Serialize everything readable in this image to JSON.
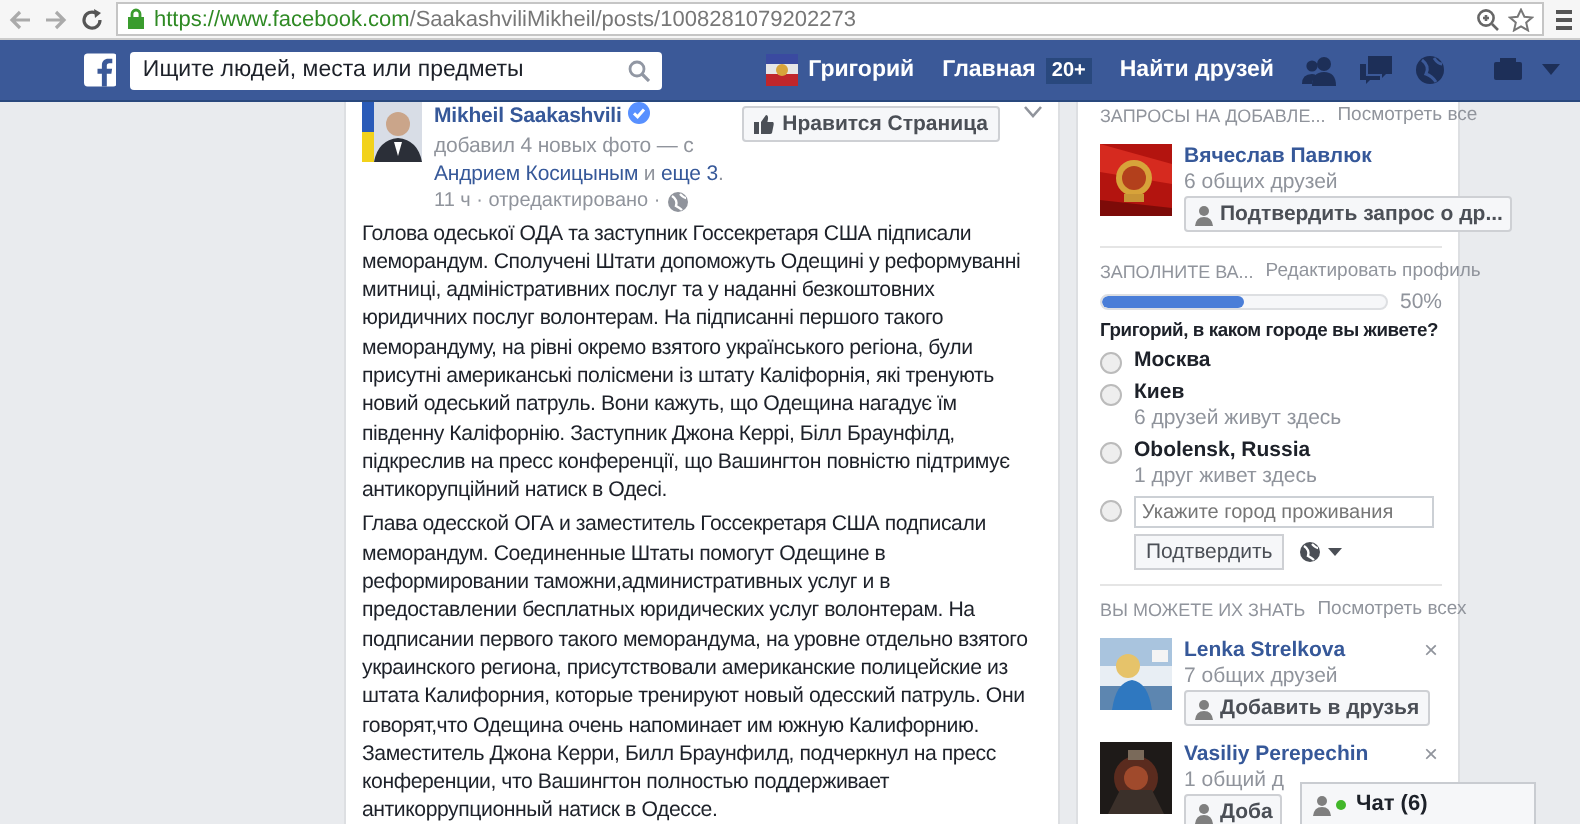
{
  "browser": {
    "url_host": "https://www.facebook.com",
    "url_path": "/SaakashviliMikheil/posts/1008281079202273"
  },
  "navbar": {
    "search_placeholder": "Ищите людей, места или предметы",
    "user": "Григорий",
    "home": "Главная",
    "home_badge": "20+",
    "find_friends": "Найти друзей"
  },
  "post": {
    "author": "Mikheil Saakashvili",
    "verified": true,
    "headline": [
      {
        "kind": "text",
        "text": "добавил 4 новых фото — с "
      },
      {
        "kind": "link",
        "text": "Андрием Косицыным"
      },
      {
        "kind": "text",
        "text": " и "
      },
      {
        "kind": "link",
        "text": "еще 3"
      },
      {
        "kind": "text",
        "text": "."
      }
    ],
    "meta": "11 ч · отредактировано ·",
    "like_button": "Нравится Страница",
    "paragraphs": [
      "Голова одеської ОДА та заступник Госсекретаря США підписали меморандум. Сполучені Штати допоможуть Одещині у реформуванні митниці, адміністративних послуг та у наданні безкоштовних юридичних послуг волонтерам. На підписанні першого такого меморандуму, на рівні окремо взятого українського регіона, були присутні американські полісмени із штату Каліфорнія, які тренують новий одеський патруль. Вони кажуть, що Одещина нагадує їм південну Каліфорнію. Заступник Джона Керрі, Білл Браунфілд, підкреслив на пресс конференції, що Вашингтон повністю підтримує антикорупційний натиск в Одесі.",
      "Глава одесской ОГА и заместитель Госсекретаря США подписали меморандум. Соединенные Штаты помогут Одещине в реформировании таможни,административных услуг и в предоставлении бесплатных юридических услуг волонтерам. На подписании первого такого меморандума, на уровне отдельно взятого украинского региона, присутствовали американские полицейские из штата Калифорния, которые тренируют новый одесский патруль. Они говорят,что Одещина очень напоминает им южную Калифорнию. Заместитель Джона Керри, Билл Браунфилд, подчеркнул на пресс конференции, что Вашингтон полностью поддерживает антикоррупционный натиск в Одессе."
    ]
  },
  "friend_requests": {
    "title": "ЗАПРОСЫ НА ДОБАВЛЕ...",
    "see_all": "Посмотреть все",
    "items": [
      {
        "name": "Вячеслав Павлюк",
        "mutual": "6 общих друзей",
        "button": "Подтвердить запрос о др..."
      }
    ]
  },
  "profile_completion": {
    "title": "ЗАПОЛНИТЕ ВА...",
    "edit": "Редактировать профиль",
    "level": 0.5,
    "percent": "50%",
    "question": "Григорий, в каком городе вы живете?",
    "options": [
      {
        "label": "Москва",
        "selected": false
      },
      {
        "label": "Киев",
        "note": "6 друзей живут здесь",
        "selected": false
      },
      {
        "label": "Obolensk, Russia",
        "note": "1 друг живет здесь",
        "selected": false
      },
      {
        "kind": "input",
        "placeholder": "Укажите город проживания",
        "selected": false
      }
    ],
    "confirm": "Подтвердить"
  },
  "people_you_may_know": {
    "title": "ВЫ МОЖЕТЕ ИХ ЗНАТЬ",
    "see_all": "Посмотреть всех",
    "people": [
      {
        "name": "Lenka Strelkova",
        "mutual": "7 общих друзей",
        "button": "Добавить в друзья",
        "dismiss": "×"
      },
      {
        "name": "Vasiliy Perepechin",
        "mutual": "1 общий д",
        "button": "Доба",
        "dismiss": "×"
      }
    ]
  },
  "chat": {
    "label": "Чат (6)"
  }
}
